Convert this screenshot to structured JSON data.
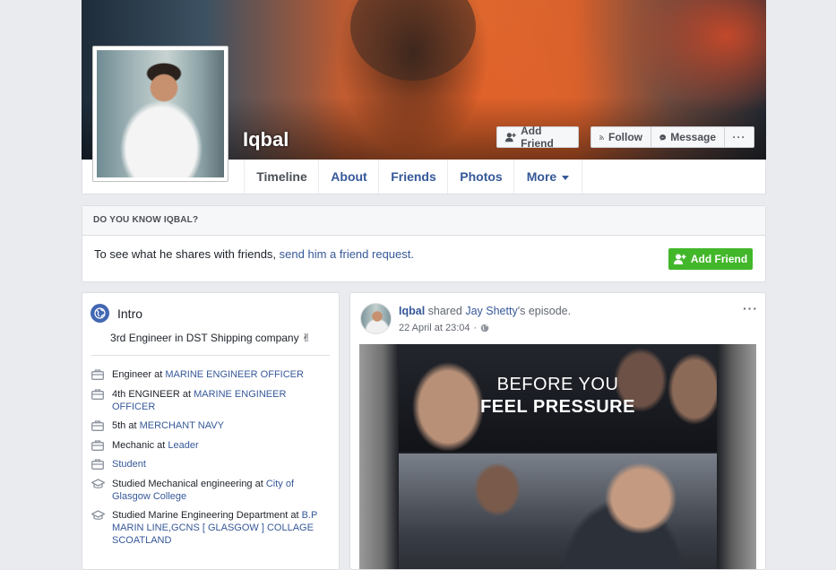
{
  "profile": {
    "name": "Iqbal",
    "buttons": {
      "add_friend": "Add Friend",
      "follow": "Follow",
      "message": "Message",
      "more": "···"
    }
  },
  "nav": {
    "tabs": [
      "Timeline",
      "About",
      "Friends",
      "Photos",
      "More"
    ],
    "active": "Timeline"
  },
  "know": {
    "header": "DO YOU KNOW IQBAL?",
    "text": "To see what he shares with friends, ",
    "link": "send him a friend request.",
    "button": "Add Friend"
  },
  "intro": {
    "title": "Intro",
    "bio": "3rd Engineer in DST Shipping company ✌",
    "items": [
      {
        "icon": "briefcase-icon",
        "prefix": "Engineer at ",
        "link": "MARINE ENGINEER OFFICER"
      },
      {
        "icon": "briefcase-icon",
        "prefix": "4th ENGINEER at ",
        "link": "MARINE ENGINEER OFFICER"
      },
      {
        "icon": "briefcase-icon",
        "prefix": "5th at ",
        "link": "MERCHANT NAVY"
      },
      {
        "icon": "briefcase-icon",
        "prefix": "Mechanic at ",
        "link": "Leader"
      },
      {
        "icon": "briefcase-icon",
        "prefix": "",
        "link": "Student"
      },
      {
        "icon": "graduation-cap-icon",
        "prefix": "Studied Mechanical engineering at ",
        "link": "City of Glasgow College"
      },
      {
        "icon": "graduation-cap-icon",
        "prefix": "Studied Marine Engineering Department at ",
        "link": "B.P MARIN LINE,GCNS [ GLASGOW ] COLLAGE SCOATLAND"
      }
    ]
  },
  "post": {
    "author": "Iqbal",
    "action": " shared ",
    "page": "Jay Shetty",
    "suffix": "'s episode.",
    "date": "22 April at 23:04",
    "separator": "·",
    "menu": "···",
    "video_line1": "BEFORE YOU",
    "video_line2": "FEEL PRESSURE"
  },
  "colors": {
    "brand_blue": "#4267b2",
    "link": "#365899",
    "green": "#42b72a",
    "background": "#e9ebee"
  }
}
